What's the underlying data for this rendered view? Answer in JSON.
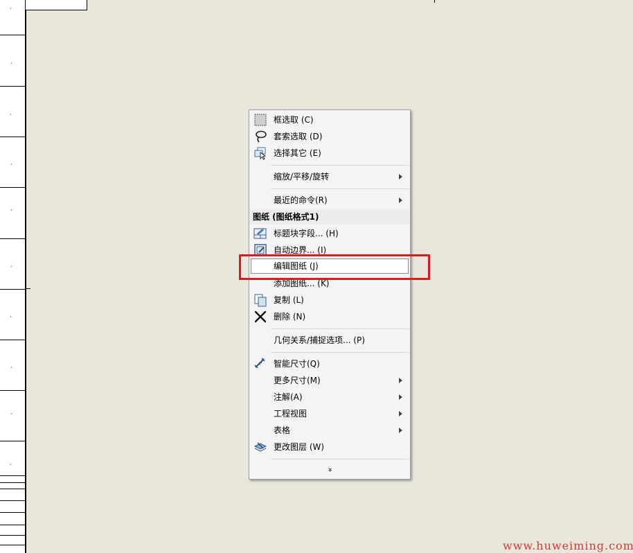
{
  "menu": {
    "items": [
      {
        "label": "框选取 (C)",
        "icon": "box-select-icon"
      },
      {
        "label": "套索选取 (D)",
        "icon": "lasso-select-icon"
      },
      {
        "label": "选择其它 (E)",
        "icon": "select-other-icon"
      },
      {
        "label": "缩放/平移/旋转"
      },
      {
        "label": "最近的命令(R)"
      },
      {
        "label": "标题块字段... (H)",
        "icon": "title-block-icon"
      },
      {
        "label": "自动边界... (I)",
        "icon": "auto-border-icon"
      },
      {
        "label": "编辑图纸 (J)"
      },
      {
        "label": "添加图纸... (K)"
      },
      {
        "label": "复制 (L)",
        "icon": "copy-icon"
      },
      {
        "label": "删除 (N)",
        "icon": "delete-icon"
      },
      {
        "label": "几何关系/捕捉选项... (P)"
      },
      {
        "label": "智能尺寸(Q)",
        "icon": "smart-dimension-icon"
      },
      {
        "label": "更多尺寸(M)"
      },
      {
        "label": "注解(A)"
      },
      {
        "label": "工程视图"
      },
      {
        "label": "表格"
      },
      {
        "label": "更改图层 (W)",
        "icon": "change-layer-icon"
      }
    ],
    "section_header": "图纸 (图纸格式1)",
    "expand_glyph": "»"
  },
  "watermark": "www.huweiming.com",
  "colors": {
    "highlight": "#e0191f",
    "background": "#e9e7dc",
    "watermark": "#d23a3a"
  }
}
